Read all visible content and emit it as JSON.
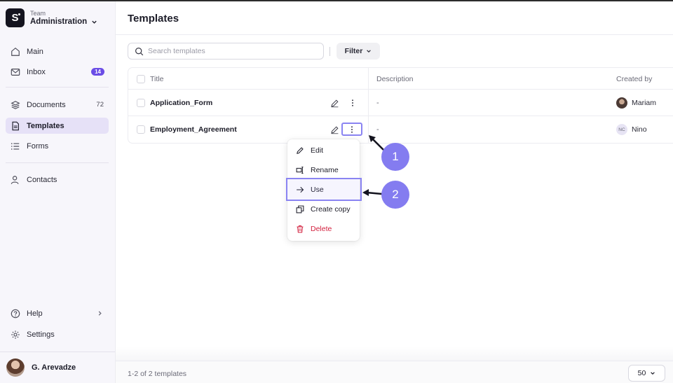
{
  "team": {
    "logo_letter": "S",
    "label": "Team",
    "name": "Administration"
  },
  "sidebar": {
    "items": [
      {
        "label": "Main",
        "icon": "home-icon"
      },
      {
        "label": "Inbox",
        "icon": "mail-icon",
        "badge": "14"
      },
      {
        "label": "Documents",
        "icon": "layers-icon",
        "count": "72"
      },
      {
        "label": "Templates",
        "icon": "file-icon",
        "active": true
      },
      {
        "label": "Forms",
        "icon": "list-icon"
      },
      {
        "label": "Contacts",
        "icon": "user-icon"
      }
    ],
    "bottom": [
      {
        "label": "Help",
        "icon": "help-icon"
      },
      {
        "label": "Settings",
        "icon": "gear-icon"
      }
    ],
    "user": {
      "name": "G. Arevadze"
    }
  },
  "page": {
    "title": "Templates"
  },
  "search": {
    "placeholder": "Search templates"
  },
  "filter": {
    "label": "Filter"
  },
  "table": {
    "columns": {
      "title": "Title",
      "description": "Description",
      "created_by": "Created by"
    },
    "rows": [
      {
        "title": "Application_Form",
        "description": "-",
        "creator": "Mariam",
        "avatar": "photo"
      },
      {
        "title": "Employment_Agreement",
        "description": "-",
        "creator": "Nino",
        "initials": "NC"
      }
    ]
  },
  "menu": {
    "items": [
      {
        "label": "Edit",
        "icon": "pencil-icon"
      },
      {
        "label": "Rename",
        "icon": "rename-icon"
      },
      {
        "label": "Use",
        "icon": "arrow-right-icon",
        "highlighted": true
      },
      {
        "label": "Create copy",
        "icon": "copy-icon"
      },
      {
        "label": "Delete",
        "icon": "trash-icon",
        "danger": true
      }
    ]
  },
  "annotations": {
    "step1": "1",
    "step2": "2",
    "accent": "#847cf0"
  },
  "footer": {
    "summary": "1-2 of 2 templates",
    "per_page": "50"
  },
  "colors": {
    "accent": "#6b4de6",
    "active_bg": "#e6e1f7",
    "danger": "#d21e3c"
  }
}
